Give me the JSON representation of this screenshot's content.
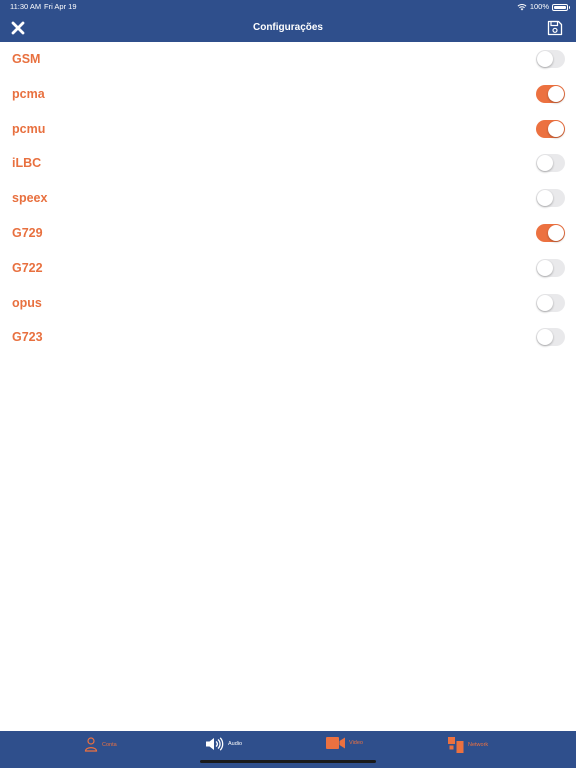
{
  "status_bar": {
    "time": "11:30 AM",
    "date": "Fri Apr 19",
    "battery": "100%"
  },
  "header": {
    "title": "Configurações"
  },
  "icons": {
    "close": "close-icon",
    "save": "save-icon"
  },
  "colors": {
    "header_bg": "#2f4f8c",
    "accent": "#ec7140",
    "label": "#e8703f",
    "switch_off": "#e9e9eb"
  },
  "codecs": [
    {
      "label": "GSM",
      "enabled": false
    },
    {
      "label": "pcma",
      "enabled": true
    },
    {
      "label": "pcmu",
      "enabled": true
    },
    {
      "label": "iLBC",
      "enabled": false
    },
    {
      "label": "speex",
      "enabled": false
    },
    {
      "label": "G729",
      "enabled": true
    },
    {
      "label": "G722",
      "enabled": false
    },
    {
      "label": "opus",
      "enabled": false
    },
    {
      "label": "G723",
      "enabled": false
    }
  ],
  "tabs": [
    {
      "label": "Conta",
      "icon": "person-icon",
      "active": false
    },
    {
      "label": "Audio",
      "icon": "speaker-icon",
      "active": true
    },
    {
      "label": "Video",
      "icon": "video-camera-icon",
      "active": false
    },
    {
      "label": "Network",
      "icon": "network-icon",
      "active": false
    }
  ]
}
